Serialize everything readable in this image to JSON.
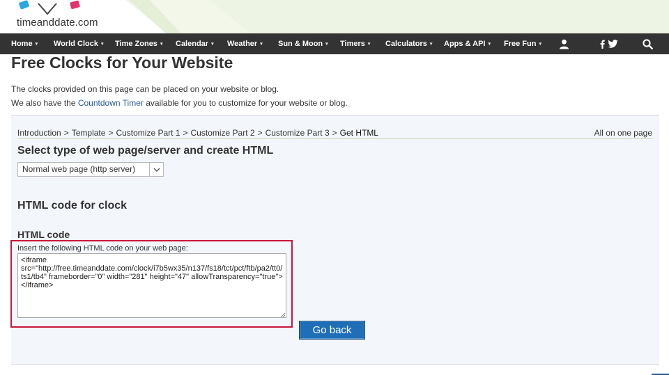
{
  "brand": {
    "name": "timeanddate.com"
  },
  "nav": {
    "items": [
      {
        "label": "Home",
        "caret": "▾"
      },
      {
        "label": "World Clock",
        "caret": "▾"
      },
      {
        "label": "Time Zones",
        "caret": "▾"
      },
      {
        "label": "Calendar",
        "caret": "▾"
      },
      {
        "label": "Weather",
        "caret": "▾"
      },
      {
        "label": "Sun & Moon",
        "caret": "▾"
      },
      {
        "label": "Timers",
        "caret": "▾"
      },
      {
        "label": "Calculators",
        "caret": "▾"
      },
      {
        "label": "Apps & API",
        "caret": "▾"
      },
      {
        "label": "Free Fun",
        "caret": "▾"
      }
    ],
    "icons": [
      "user-icon",
      "facebook-icon",
      "twitter-icon",
      "search-icon"
    ]
  },
  "page": {
    "title": "Free Clocks for Your Website",
    "intro_line1": "The clocks provided on this page can be placed on your website or blog.",
    "intro_line2_before": "We also have the ",
    "intro_line2_link": "Countdown Timer",
    "intro_line2_after": " available for you to customize for your website or blog."
  },
  "breadcrumb": {
    "items": [
      "Introduction",
      "Template",
      "Customize Part 1",
      "Customize Part 2",
      "Customize Part 3"
    ],
    "separator": ">",
    "current": "Get HTML",
    "all_on_one": "All on one page"
  },
  "form": {
    "select_heading": "Select type of web page/server and create HTML",
    "select_value": "Normal web page (http server)",
    "clock_heading": "HTML code for clock",
    "code_heading": "HTML code",
    "insert_label": "Insert the following HTML code on your web page:",
    "code": "<iframe src=\"http://free.timeanddate.com/clock/i7b5wx35/n137/fs18/tct/pct/ftb/pa2/tt0/ts1/tb4\" frameborder=\"0\" width=\"281\" height=\"47\" allowTransparency=\"true\"></iframe>",
    "go_back": "Go back"
  },
  "colors": {
    "navbar": "#333333",
    "link": "#2a5c9a",
    "highlight": "#c8173a",
    "button": "#1f6fb8",
    "panel": "#f3f6fa"
  }
}
